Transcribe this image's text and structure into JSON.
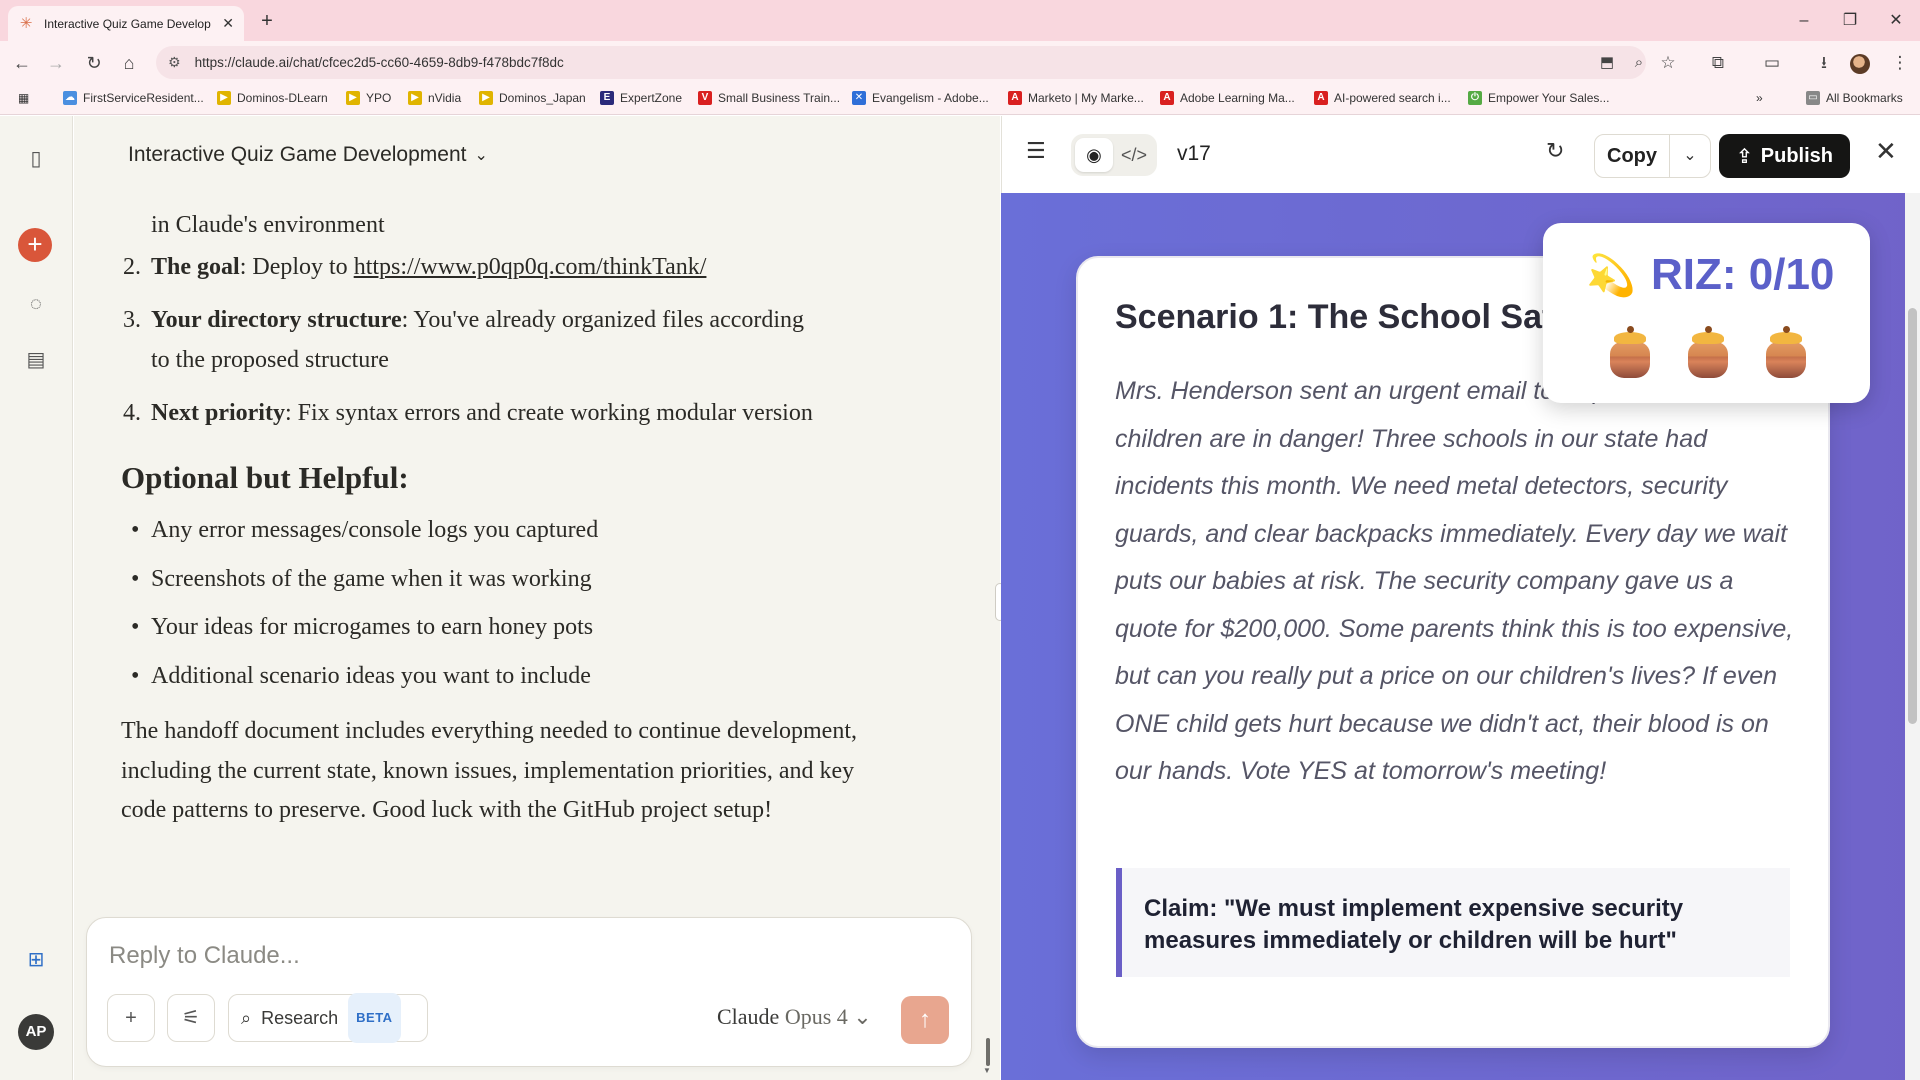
{
  "browser": {
    "tab_title": "Interactive Quiz Game Develop",
    "url": "https://claude.ai/chat/cfcec2d5-cc60-4659-8db9-f478bdc7f8dc",
    "bookmarks": [
      {
        "label": "FirstServiceResident...",
        "color": "#4a8fe0"
      },
      {
        "label": "Dominos-DLearn",
        "color": "#e0b400"
      },
      {
        "label": "YPO",
        "color": "#e0b400"
      },
      {
        "label": "nVidia",
        "color": "#e0b400"
      },
      {
        "label": "Dominos_Japan",
        "color": "#e0b400"
      },
      {
        "label": "ExpertZone",
        "color": "#2a2a7a"
      },
      {
        "label": "Small Business Train...",
        "color": "#d92020"
      },
      {
        "label": "Evangelism - Adobe...",
        "color": "#2f6fd8"
      },
      {
        "label": "Marketo | My Marke...",
        "color": "#d92020"
      },
      {
        "label": "Adobe Learning Ma...",
        "color": "#d92020"
      },
      {
        "label": "AI-powered search i...",
        "color": "#d92020"
      },
      {
        "label": "Empower Your Sales...",
        "color": "#55aa44"
      }
    ],
    "all_bookmarks": "All Bookmarks"
  },
  "chat": {
    "title": "Interactive Quiz Game Development",
    "continuation": "in Claude's environment",
    "list": [
      {
        "num": "2.",
        "bold": "The goal",
        "text": ": Deploy to ",
        "link": "https://www.p0qp0q.com/thinkTank/"
      },
      {
        "num": "3.",
        "bold": "Your directory structure",
        "text": ": You've already organized files according",
        "text2": "to the proposed structure"
      },
      {
        "num": "4.",
        "bold": "Next priority",
        "text": ": Fix syntax errors and create working modular version"
      }
    ],
    "optional_heading": "Optional but Helpful:",
    "bullets": [
      "Any error messages/console logs you captured",
      "Screenshots of the game when it was working",
      "Your ideas for microgames to earn honey pots",
      "Additional scenario ideas you want to include"
    ],
    "closing": "The handoff document includes everything needed to continue development, including the current state, known issues, implementation priorities, and key code patterns to preserve. Good luck with the GitHub project setup!"
  },
  "composer": {
    "placeholder": "Reply to Claude...",
    "research_label": "Research",
    "beta_label": "BETA",
    "model_brand": "Claude",
    "model_version": "Opus 4"
  },
  "rail": {
    "avatar_initials": "AP"
  },
  "artifact": {
    "version": "v17",
    "copy_label": "Copy",
    "publish_label": "Publish",
    "riz_label": "RIZ: 0/10",
    "scenario_title": "Scenario 1: The School Safety Crisis",
    "scenario_text": "Mrs. Henderson sent an urgent email to all parents: \"Our children are in danger! Three schools in our state had incidents this month. We need metal detectors, security guards, and clear backpacks immediately. Every day we wait puts our babies at risk. The security company gave us a quote for $200,000. Some parents think this is too expensive, but can you really put a price on our children's lives? If even ONE child gets hurt because we didn't act, their blood is on our hands. Vote YES at tomorrow's meeting!",
    "claim": "Claim: \"We must implement expensive security measures immediately or children will be hurt\"",
    "honey_pots": 3
  },
  "colors": {
    "accent": "#d9563a",
    "artifact_bg": "#6a6fd8",
    "riz": "#5b60c9",
    "claim_border": "#6a5fc7"
  }
}
